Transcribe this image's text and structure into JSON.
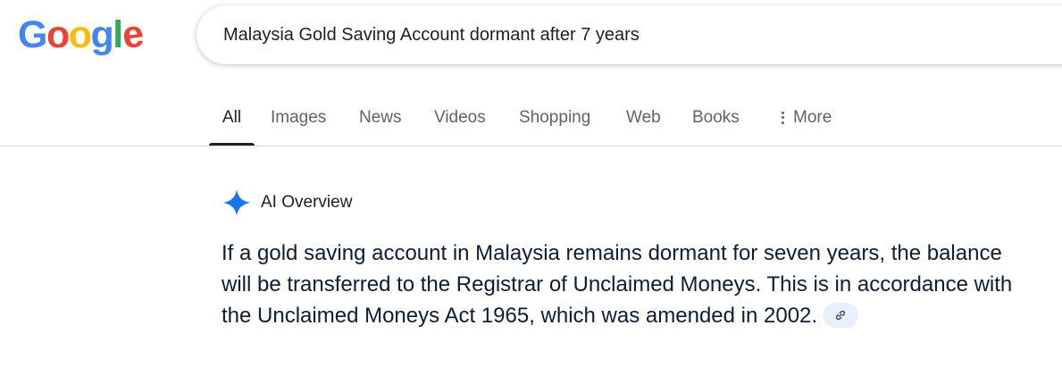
{
  "logo": {
    "letters": [
      "G",
      "o",
      "o",
      "g",
      "l",
      "e"
    ],
    "colors": [
      "#4285F4",
      "#EA4335",
      "#FBBC05",
      "#4285F4",
      "#34A853",
      "#EA4335"
    ]
  },
  "search": {
    "value": "Malaysia Gold Saving Account dormant after 7 years"
  },
  "tabs": [
    {
      "label": "All",
      "active": true
    },
    {
      "label": "Images"
    },
    {
      "label": "News"
    },
    {
      "label": "Videos"
    },
    {
      "label": "Shopping"
    },
    {
      "label": "Web"
    },
    {
      "label": "Books"
    },
    {
      "label": "More",
      "icon": "more-vert-icon"
    }
  ],
  "ai_overview": {
    "title": "AI Overview",
    "icon": "sparkle-icon",
    "icon_color": "#1a73e8",
    "body": "If a gold saving account in Malaysia remains dormant for seven years, the balance will be transferred to the Registrar of Unclaimed Moneys. This is in accordance with the Unclaimed Moneys Act 1965, which was amended in 2002.",
    "link_icon": "link-icon",
    "link_chip_color": "#e8f0fe"
  }
}
